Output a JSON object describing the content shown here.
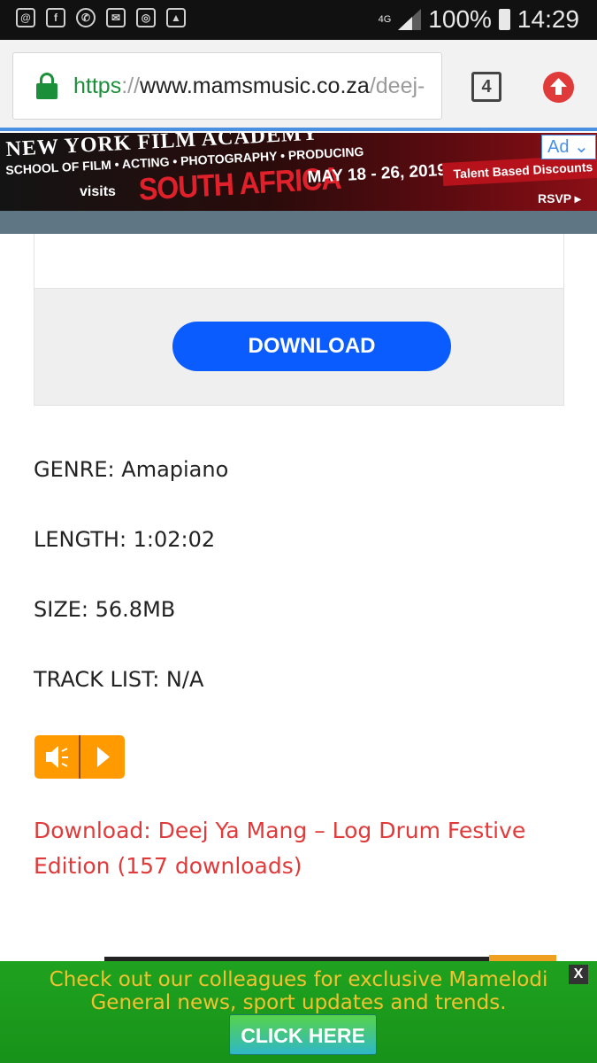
{
  "statusbar": {
    "network": "4G",
    "battery": "100%",
    "time": "14:29",
    "notification_icons": [
      "email-icon",
      "facebook-icon",
      "whatsapp-icon",
      "mail-icon",
      "instagram-icon",
      "gallery-icon"
    ]
  },
  "browser": {
    "url_scheme": "https",
    "url_separator": "://",
    "url_host": "www.mamsmusic.co.za",
    "url_path": "/deej-",
    "tab_count": "4"
  },
  "ad": {
    "headline": "NEW YORK FILM ACADEMY",
    "subline": "SCHOOL OF FILM • ACTING • PHOTOGRAPHY • PRODUCING",
    "visits": "visits",
    "country": "SOUTH AFRICA",
    "dates": "MAY 18 - 26, 2019",
    "talent": "Talent Based Discounts",
    "rsvp": "RSVP ▸",
    "ad_label": "Ad ⌄"
  },
  "player": {
    "download_label": "DOWNLOAD"
  },
  "info": {
    "genre": "GENRE: Amapiano",
    "length": "LENGTH: 1:02:02",
    "size": "SIZE: 56.8MB",
    "tracklist": "TRACK LIST: N/A"
  },
  "download_link": "Download: Deej Ya Mang – Log Drum Festive Edition (157 downloads)",
  "promo": {
    "line1": "Check out our colleagues for exclusive Mamelodi",
    "line2": "General news, sport updates and trends.",
    "button": "CLICK HERE",
    "close": "X"
  },
  "colors": {
    "download_button": "#0a5cff",
    "link_red": "#e03a3a",
    "promo_green": "#1fa21f",
    "promo_text": "#f2c230",
    "audio_orange": "#ff9a00"
  }
}
